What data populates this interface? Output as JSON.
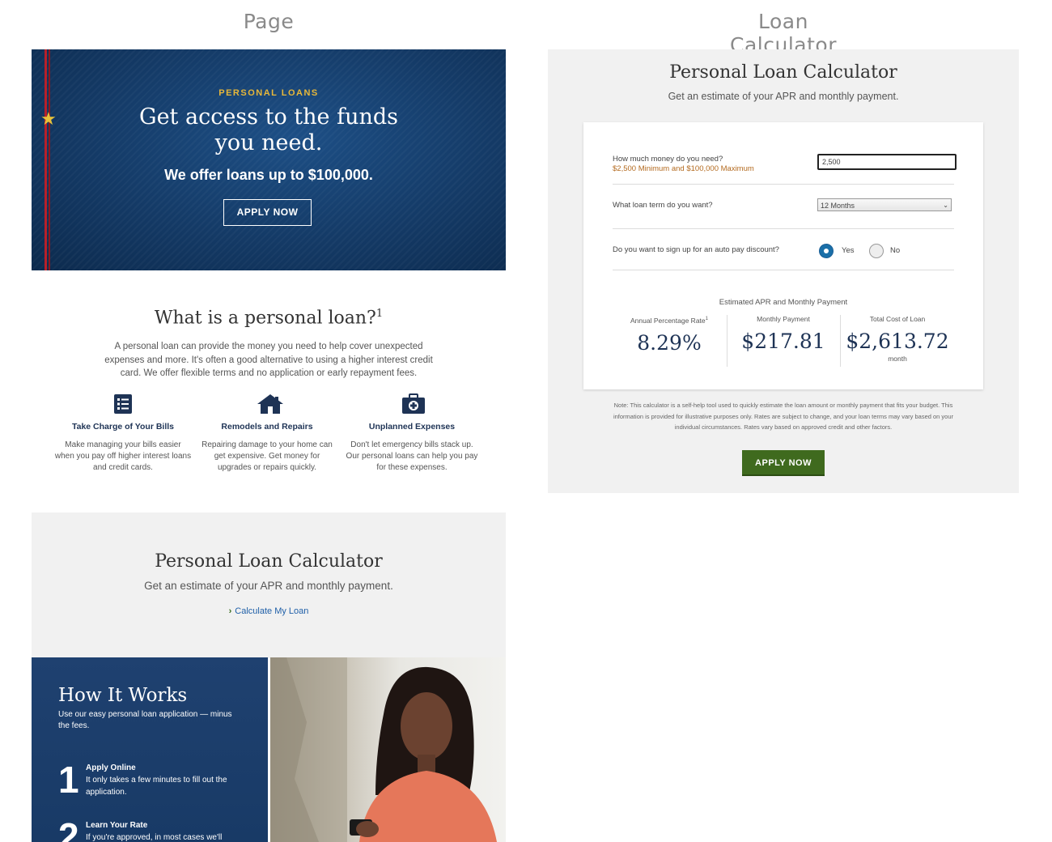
{
  "columns": {
    "left_title": "Page",
    "right_title": "Loan Calculator"
  },
  "hero": {
    "eyebrow": "PERSONAL LOANS",
    "headline_line1": "Get access to the funds",
    "headline_line2": "you need.",
    "subhead": "We offer loans up to $100,000.",
    "cta": "APPLY NOW"
  },
  "what": {
    "title": "What is a personal loan?",
    "footnote": "1",
    "description": "A personal loan can provide the money you need to help cover unexpected expenses and more. It's often a good alternative to using a higher interest credit card. We offer flexible terms and no application or early repayment fees.",
    "features": [
      {
        "icon": "checklist-icon",
        "title": "Take Charge of Your Bills",
        "desc": "Make managing your bills easier when you pay off higher interest loans and credit cards."
      },
      {
        "icon": "house-icon",
        "title": "Remodels and Repairs",
        "desc": "Repairing damage to your home can get expensive. Get money for upgrades or repairs quickly."
      },
      {
        "icon": "medical-kit-icon",
        "title": "Unplanned Expenses",
        "desc": "Don't let emergency bills stack up. Our personal loans can help you pay for these expenses."
      }
    ]
  },
  "teaser": {
    "title": "Personal Loan Calculator",
    "subtitle": "Get an estimate of your APR and monthly payment.",
    "link": "Calculate My Loan"
  },
  "how": {
    "title": "How It Works",
    "subtitle": "Use our easy personal loan application — minus the fees.",
    "steps": [
      {
        "num": "1",
        "title": "Apply Online",
        "desc": "It only takes a few minutes to fill out the application."
      },
      {
        "num": "2",
        "title": "Learn Your Rate",
        "desc": "If you're approved, in most cases we'll"
      }
    ]
  },
  "calculator": {
    "title": "Personal Loan Calculator",
    "subtitle": "Get an estimate of your APR and monthly payment.",
    "q_amount": "How much money do you need?",
    "q_amount_hint": "$2,500 Minimum and $100,000 Maximum",
    "amount_value": "2,500",
    "q_term": "What loan term do you want?",
    "term_value": "12 Months",
    "q_autopay": "Do you want to sign up for an auto pay discount?",
    "autopay_yes": "Yes",
    "autopay_no": "No",
    "autopay_selected": "Yes",
    "results_title": "Estimated APR and Monthly Payment",
    "apr_label": "Annual Percentage Rate",
    "apr_footnote": "1",
    "apr_value": "8.29%",
    "monthly_label": "Monthly Payment",
    "monthly_value": "$217.81",
    "total_label": "Total Cost of Loan",
    "total_value": "$2,613.72",
    "total_unit": "month",
    "note": "Note: This calculator is a self-help tool used to quickly estimate the loan amount or monthly payment that fits your budget. This information is provided for illustrative purposes only. Rates are subject to change, and your loan terms may vary based on your individual circumstances. Rates vary based on approved credit and other factors.",
    "cta": "APPLY NOW"
  },
  "colors": {
    "navy": "#143a66",
    "gold": "#e8b83a",
    "green": "#3f6a1e",
    "link": "#1f5fa8"
  }
}
